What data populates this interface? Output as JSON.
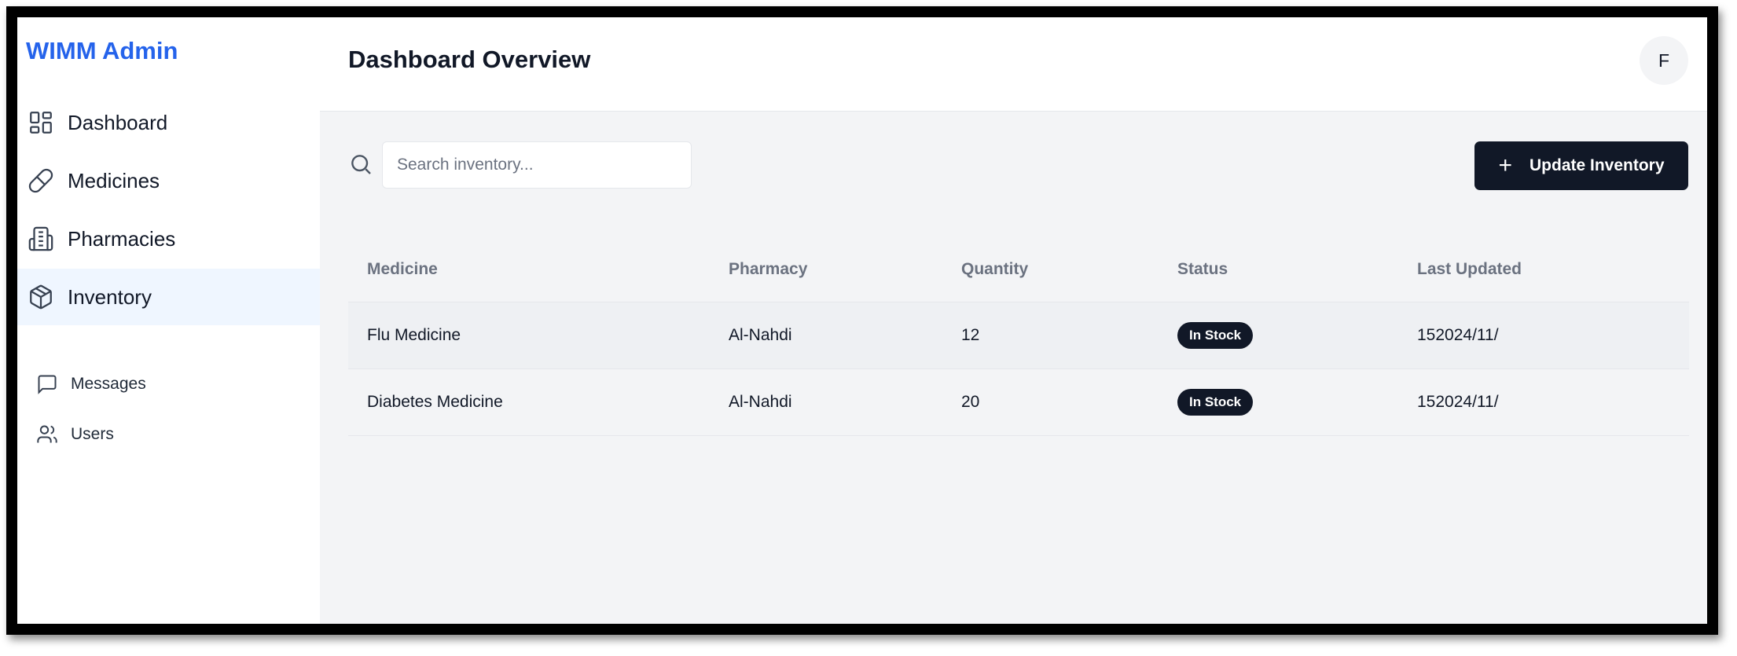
{
  "sidebar": {
    "brand": "WIMM Admin",
    "items": [
      {
        "label": "Dashboard",
        "icon": "dashboard-icon"
      },
      {
        "label": "Medicines",
        "icon": "pill-icon"
      },
      {
        "label": "Pharmacies",
        "icon": "building-icon"
      },
      {
        "label": "Inventory",
        "icon": "package-icon",
        "active": true
      },
      {
        "label": "Messages",
        "icon": "message-icon"
      },
      {
        "label": "Users",
        "icon": "users-icon"
      }
    ]
  },
  "header": {
    "title": "Dashboard Overview",
    "avatar_initial": "F"
  },
  "toolbar": {
    "search_placeholder": "Search inventory...",
    "update_label": "Update Inventory"
  },
  "table": {
    "columns": [
      "Medicine",
      "Pharmacy",
      "Quantity",
      "Status",
      "Last Updated"
    ],
    "rows": [
      {
        "medicine": "Flu Medicine",
        "pharmacy": "Al-Nahdi",
        "quantity": "12",
        "status": "In Stock",
        "updated": "152024/11/"
      },
      {
        "medicine": "Diabetes Medicine",
        "pharmacy": "Al-Nahdi",
        "quantity": "20",
        "status": "In Stock",
        "updated": "152024/11/"
      }
    ]
  },
  "colors": {
    "brand": "#2563eb",
    "primary_button": "#111827",
    "active_nav_bg": "#eff6ff",
    "main_bg": "#f3f4f6"
  }
}
